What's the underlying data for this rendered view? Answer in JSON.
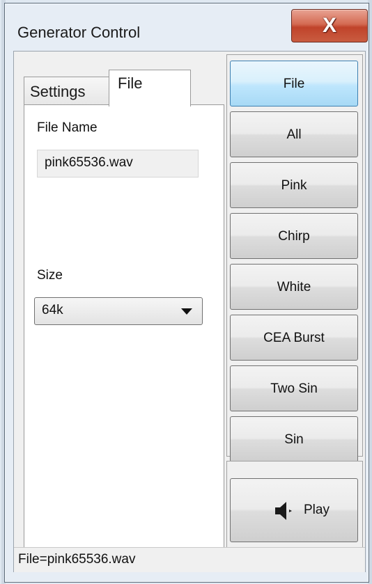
{
  "window": {
    "title": "Generator Control",
    "close_label": "X"
  },
  "tabs": [
    {
      "label": "Settings"
    },
    {
      "label": "File"
    }
  ],
  "file_tab": {
    "file_name_label": "File Name",
    "file_name_value": "pink65536.wav",
    "size_label": "Size",
    "size_value": "64k"
  },
  "buttons": [
    {
      "label": "File"
    },
    {
      "label": "All"
    },
    {
      "label": "Pink"
    },
    {
      "label": "Chirp"
    },
    {
      "label": "White"
    },
    {
      "label": "CEA Burst"
    },
    {
      "label": "Two Sin"
    },
    {
      "label": "Sin"
    }
  ],
  "active_button": "File",
  "play": {
    "label": "Play",
    "icon": "speaker-icon"
  },
  "status": {
    "text": "File=pink65536.wav"
  }
}
